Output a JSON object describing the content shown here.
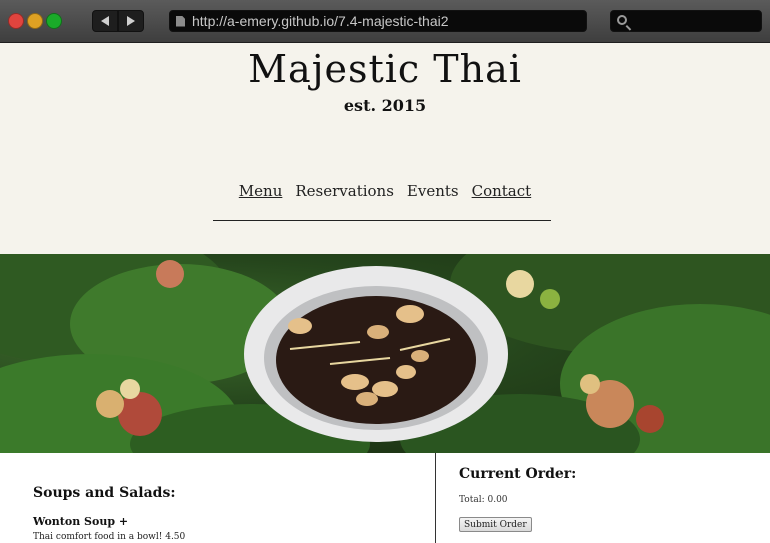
{
  "browser": {
    "url": "http://a-emery.github.io/7.4-majestic-thai2",
    "search_placeholder": "",
    "back_icon": "back-arrow-icon",
    "forward_icon": "forward-arrow-icon"
  },
  "site": {
    "title": "Majestic Thai",
    "subtitle": "est. 2015"
  },
  "nav": {
    "items": [
      "Menu",
      "Reservations",
      "Events",
      "Contact"
    ]
  },
  "menu": {
    "section_title": "Soups and Salads:",
    "items": [
      {
        "name": "Wonton Soup +",
        "description": "Thai comfort food in a bowl! 4.50"
      }
    ]
  },
  "order": {
    "title": "Current Order:",
    "total": "Total: 0.00",
    "submit_label": "Submit Order"
  },
  "colors": {
    "header_bg": "#f5f3ec",
    "text": "#111111"
  }
}
